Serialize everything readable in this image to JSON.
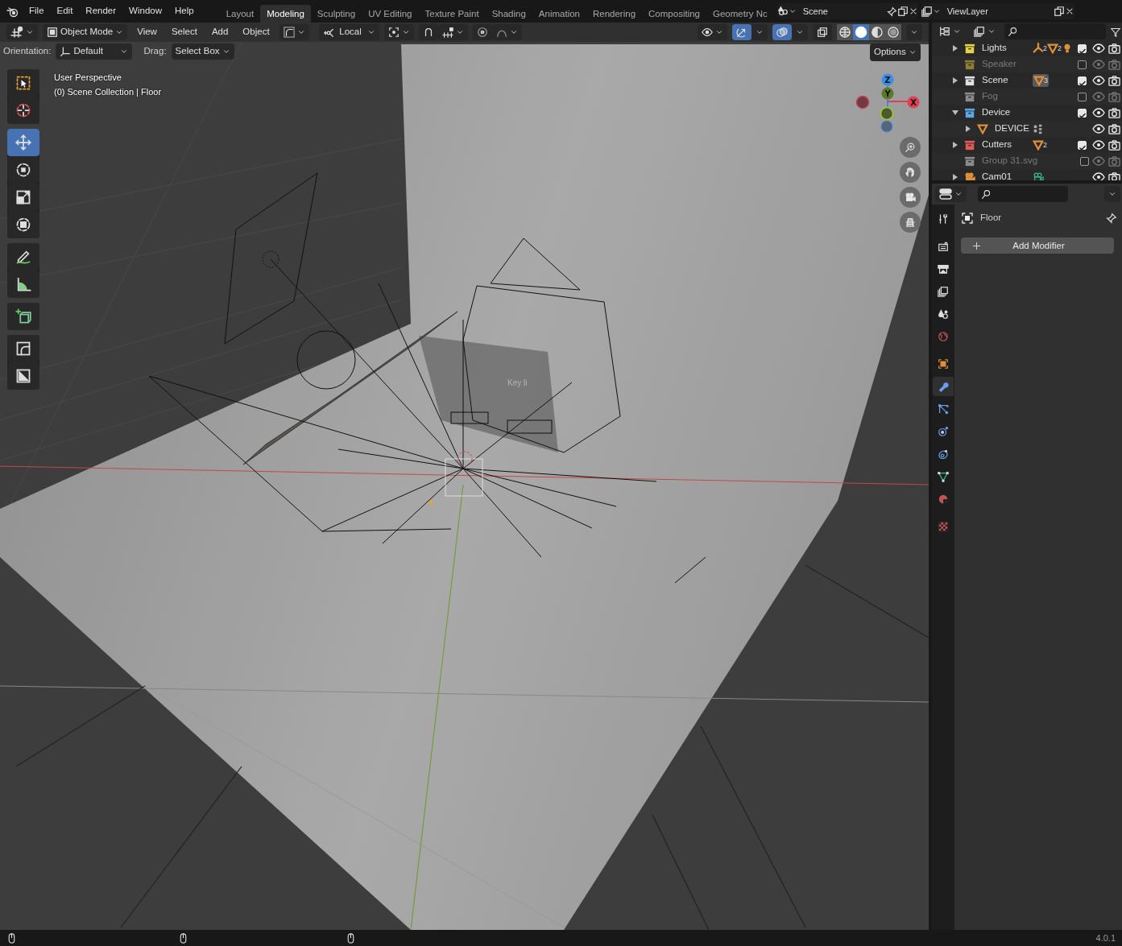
{
  "menu_bar": {
    "menus": [
      "File",
      "Edit",
      "Render",
      "Window",
      "Help"
    ]
  },
  "workspaces": [
    {
      "label": "Layout",
      "selected": false
    },
    {
      "label": "Modeling",
      "selected": true
    },
    {
      "label": "Sculpting",
      "selected": false
    },
    {
      "label": "UV Editing",
      "selected": false
    },
    {
      "label": "Texture Paint",
      "selected": false
    },
    {
      "label": "Shading",
      "selected": false
    },
    {
      "label": "Animation",
      "selected": false
    },
    {
      "label": "Rendering",
      "selected": false
    },
    {
      "label": "Compositing",
      "selected": false
    },
    {
      "label": "Geometry Nc",
      "selected": false
    }
  ],
  "scene_selector": {
    "value": "Scene"
  },
  "view_layer_selector": {
    "value": "ViewLayer"
  },
  "viewport": {
    "header": {
      "mode": "Object Mode",
      "menus": [
        "View",
        "Select",
        "Add",
        "Object"
      ],
      "pivot": "Local",
      "snap": {
        "on": false
      },
      "proportional": {
        "on": false
      },
      "gizmo": {
        "on": true
      },
      "overlay": {
        "on": true
      },
      "xray": {
        "on": false
      },
      "shading": [
        {
          "kind": "wireframe",
          "selected": false
        },
        {
          "kind": "solid",
          "selected": true
        },
        {
          "kind": "material",
          "selected": false
        },
        {
          "kind": "rendered",
          "selected": false
        }
      ]
    },
    "tool_settings": {
      "orientation_label": "Orientation:",
      "orientation": "Default",
      "drag_label": "Drag:",
      "drag": "Select Box",
      "options": "Options"
    },
    "overlay_text": [
      "User Perspective",
      "(0) Scene Collection | Floor"
    ],
    "tool_groups": [
      {
        "tools": [
          {
            "kind": "select_box",
            "selected": false
          },
          {
            "kind": "cursor",
            "selected": false
          }
        ]
      },
      {
        "tools": [
          {
            "kind": "move",
            "selected": true
          },
          {
            "kind": "rotate",
            "selected": false
          },
          {
            "kind": "scale",
            "selected": false
          },
          {
            "kind": "transform",
            "selected": false
          }
        ]
      },
      {
        "tools": [
          {
            "kind": "annotate",
            "selected": false
          },
          {
            "kind": "measure",
            "selected": false
          }
        ]
      },
      {
        "tools": [
          {
            "kind": "add_cube",
            "selected": false
          }
        ]
      },
      {
        "tools": [
          {
            "kind": "corner",
            "selected": false
          },
          {
            "kind": "diagonal",
            "selected": false
          }
        ]
      }
    ],
    "gizmo": {
      "axes": [
        "Z",
        "Y",
        "X"
      ]
    },
    "scene_label": "Key li"
  },
  "outliner": {
    "rows": [
      {
        "kind": "collection",
        "name": "Lights",
        "color": "#e8d24a",
        "expanded": false,
        "checked": true,
        "dimmed": false,
        "badges": [
          {
            "kind": "armature",
            "count": "2"
          },
          {
            "kind": "mesh",
            "count": "2"
          },
          {
            "kind": "light"
          }
        ]
      },
      {
        "kind": "collection",
        "name": "Speaker",
        "color": "#8c7f32",
        "checked": false,
        "dimmed": true
      },
      {
        "kind": "collection",
        "name": "Scene",
        "color": "#e0e0e0",
        "expanded": false,
        "checked": true,
        "dimmed": false,
        "badges": [
          {
            "kind": "mesh",
            "count": "3",
            "highlighted": true
          }
        ]
      },
      {
        "kind": "collection",
        "name": "Fog",
        "color": "#8a8a8a",
        "checked": false,
        "dimmed": true
      },
      {
        "kind": "collection",
        "name": "Device",
        "color": "#5aa8e6",
        "expanded": true,
        "checked": true,
        "dimmed": false,
        "children": [
          {
            "kind": "mesh_object",
            "name": "DEVICE",
            "expanded": false,
            "dimmed": false,
            "badges": [
              {
                "kind": "instance"
              }
            ]
          }
        ]
      },
      {
        "kind": "collection",
        "name": "Cutters",
        "color": "#e05a5a",
        "expanded": false,
        "checked": true,
        "dimmed": false,
        "badges": [
          {
            "kind": "mesh",
            "count": "2"
          }
        ]
      },
      {
        "kind": "collection",
        "name": "Group 31.svg",
        "color": "#8a8a8a",
        "checked": false,
        "dimmed": true
      },
      {
        "kind": "camera_object",
        "name": "Cam01",
        "expanded": false,
        "dimmed": false,
        "badges": [
          {
            "kind": "camera_data"
          }
        ]
      }
    ]
  },
  "properties": {
    "object_name": "Floor",
    "add_button": "Add Modifier",
    "tabs": [
      {
        "kind": "tool",
        "selected": false
      },
      {
        "kind": "render",
        "selected": false
      },
      {
        "kind": "output",
        "selected": false
      },
      {
        "kind": "view_layer",
        "selected": false
      },
      {
        "kind": "scene",
        "selected": false
      },
      {
        "kind": "world",
        "selected": false
      },
      {
        "kind": "object",
        "selected": false
      },
      {
        "kind": "modifier",
        "selected": true
      },
      {
        "kind": "particles",
        "selected": false
      },
      {
        "kind": "physics",
        "selected": false
      },
      {
        "kind": "constraints",
        "selected": false
      },
      {
        "kind": "data",
        "selected": false
      },
      {
        "kind": "material",
        "selected": false
      },
      {
        "kind": "texture",
        "selected": false
      }
    ]
  },
  "status_bar": {
    "version": "4.0.1"
  }
}
